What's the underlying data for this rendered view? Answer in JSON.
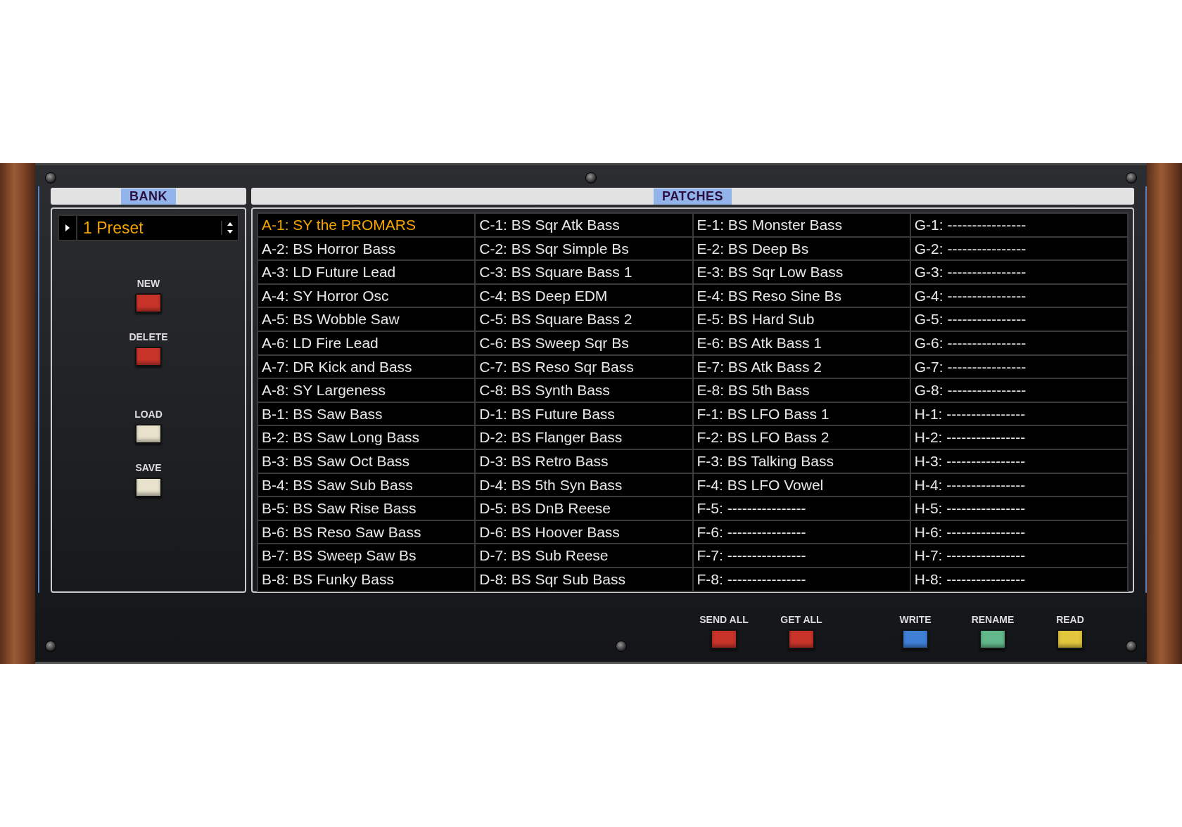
{
  "bank": {
    "title": "BANK",
    "preset": {
      "value": "1 Preset"
    },
    "buttons": [
      {
        "label": "NEW",
        "color": "#c8342a"
      },
      {
        "label": "DELETE",
        "color": "#c8342a"
      },
      {
        "label": "LOAD",
        "color": "#e8e2cc"
      },
      {
        "label": "SAVE",
        "color": "#e8e2cc"
      }
    ]
  },
  "patches": {
    "title": "PATCHES",
    "rows": [
      [
        {
          "label": "A-1: SY the PROMARS",
          "selected": true
        },
        {
          "label": "C-1: BS Sqr Atk Bass",
          "selected": false
        },
        {
          "label": "E-1: BS Monster Bass",
          "selected": false
        },
        {
          "label": "G-1: ----------------",
          "selected": false
        }
      ],
      [
        {
          "label": "A-2: BS Horror Bass",
          "selected": false
        },
        {
          "label": "C-2: BS Sqr Simple Bs",
          "selected": false
        },
        {
          "label": "E-2: BS Deep Bs",
          "selected": false
        },
        {
          "label": "G-2: ----------------",
          "selected": false
        }
      ],
      [
        {
          "label": "A-3: LD Future Lead",
          "selected": false
        },
        {
          "label": "C-3: BS Square Bass 1",
          "selected": false
        },
        {
          "label": "E-3: BS Sqr Low Bass",
          "selected": false
        },
        {
          "label": "G-3: ----------------",
          "selected": false
        }
      ],
      [
        {
          "label": "A-4: SY Horror Osc",
          "selected": false
        },
        {
          "label": "C-4: BS Deep EDM",
          "selected": false
        },
        {
          "label": "E-4: BS Reso Sine Bs",
          "selected": false
        },
        {
          "label": "G-4: ----------------",
          "selected": false
        }
      ],
      [
        {
          "label": "A-5: BS Wobble Saw",
          "selected": false
        },
        {
          "label": "C-5: BS Square Bass 2",
          "selected": false
        },
        {
          "label": "E-5: BS Hard Sub",
          "selected": false
        },
        {
          "label": "G-5: ----------------",
          "selected": false
        }
      ],
      [
        {
          "label": "A-6: LD Fire Lead",
          "selected": false
        },
        {
          "label": "C-6: BS Sweep Sqr Bs",
          "selected": false
        },
        {
          "label": "E-6: BS Atk Bass 1",
          "selected": false
        },
        {
          "label": "G-6: ----------------",
          "selected": false
        }
      ],
      [
        {
          "label": "A-7: DR Kick and Bass",
          "selected": false
        },
        {
          "label": "C-7: BS Reso Sqr Bass",
          "selected": false
        },
        {
          "label": "E-7: BS Atk Bass 2",
          "selected": false
        },
        {
          "label": "G-7: ----------------",
          "selected": false
        }
      ],
      [
        {
          "label": "A-8: SY Largeness",
          "selected": false
        },
        {
          "label": "C-8: BS Synth Bass",
          "selected": false
        },
        {
          "label": "E-8: BS 5th Bass",
          "selected": false
        },
        {
          "label": "G-8: ----------------",
          "selected": false
        }
      ],
      [
        {
          "label": "B-1: BS Saw Bass",
          "selected": false
        },
        {
          "label": "D-1: BS Future Bass",
          "selected": false
        },
        {
          "label": "F-1: BS LFO Bass 1",
          "selected": false
        },
        {
          "label": "H-1: ----------------",
          "selected": false
        }
      ],
      [
        {
          "label": "B-2: BS Saw Long Bass",
          "selected": false
        },
        {
          "label": "D-2: BS Flanger Bass",
          "selected": false
        },
        {
          "label": "F-2: BS LFO Bass 2",
          "selected": false
        },
        {
          "label": "H-2: ----------------",
          "selected": false
        }
      ],
      [
        {
          "label": "B-3: BS Saw Oct Bass",
          "selected": false
        },
        {
          "label": "D-3: BS Retro Bass",
          "selected": false
        },
        {
          "label": "F-3: BS Talking Bass",
          "selected": false
        },
        {
          "label": "H-3: ----------------",
          "selected": false
        }
      ],
      [
        {
          "label": "B-4: BS Saw Sub Bass",
          "selected": false
        },
        {
          "label": "D-4: BS 5th Syn Bass",
          "selected": false
        },
        {
          "label": "F-4: BS LFO Vowel",
          "selected": false
        },
        {
          "label": "H-4: ----------------",
          "selected": false
        }
      ],
      [
        {
          "label": "B-5: BS Saw Rise Bass",
          "selected": false
        },
        {
          "label": "D-5: BS DnB Reese",
          "selected": false
        },
        {
          "label": "F-5: ----------------",
          "selected": false
        },
        {
          "label": "H-5: ----------------",
          "selected": false
        }
      ],
      [
        {
          "label": "B-6: BS Reso Saw Bass",
          "selected": false
        },
        {
          "label": "D-6: BS Hoover Bass",
          "selected": false
        },
        {
          "label": "F-6: ----------------",
          "selected": false
        },
        {
          "label": "H-6: ----------------",
          "selected": false
        }
      ],
      [
        {
          "label": "B-7: BS Sweep Saw Bs",
          "selected": false
        },
        {
          "label": "D-7: BS Sub Reese",
          "selected": false
        },
        {
          "label": "F-7: ----------------",
          "selected": false
        },
        {
          "label": "H-7: ----------------",
          "selected": false
        }
      ],
      [
        {
          "label": "B-8: BS Funky Bass",
          "selected": false
        },
        {
          "label": "D-8: BS Sqr Sub Bass",
          "selected": false
        },
        {
          "label": "F-8: ----------------",
          "selected": false
        },
        {
          "label": "H-8: ----------------",
          "selected": false
        }
      ]
    ]
  },
  "actions": [
    {
      "label": "SEND ALL",
      "color": "#c8342a"
    },
    {
      "label": "GET ALL",
      "color": "#c8342a"
    },
    {
      "label": "WRITE",
      "color": "#3f7fd6"
    },
    {
      "label": "RENAME",
      "color": "#62b88a"
    },
    {
      "label": "READ",
      "color": "#e2c63e"
    }
  ]
}
